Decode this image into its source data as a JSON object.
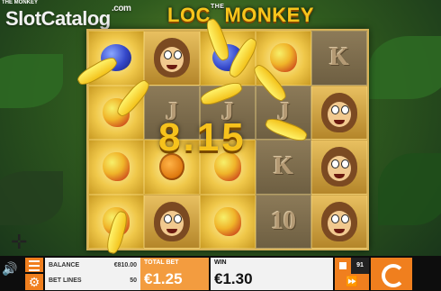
{
  "watermark": {
    "brand": "SlotCatalog",
    "domain": ".com"
  },
  "header": {
    "small_title": "THE MONKEY",
    "logo_text": "LOC",
    "logo_text_2": "MONKEY",
    "logo_small": "THE"
  },
  "win_overlay": {
    "amount": "8.15"
  },
  "reels": [
    [
      "plum",
      "mango",
      "mango",
      "mango"
    ],
    [
      "monkey",
      "J",
      "lychee",
      "monkey"
    ],
    [
      "plum",
      "J",
      "mango",
      "mango"
    ],
    [
      "mango",
      "J",
      "K",
      "10"
    ],
    [
      "K",
      "monkey",
      "monkey",
      "monkey"
    ]
  ],
  "bottom_bar": {
    "balance_label": "BALANCE",
    "balance_value": "€810.00",
    "bet_lines_label": "BET LINES",
    "bet_lines_value": "50",
    "total_bet_label": "TOTAL BET",
    "total_bet_value": "€1.25",
    "win_label": "WIN",
    "win_value": "€1.30",
    "autoplay_count": "91",
    "fast_label": "⏩"
  },
  "colors": {
    "accent": "#f07f1e",
    "win_text": "#f6c21c",
    "frame": "#d7b25a"
  },
  "icons": {
    "menu": "hamburger-menu-icon",
    "settings": "gear-icon",
    "spin": "spin-arrow-icon",
    "autoplay": "stop-square-icon",
    "fast": "fast-forward-icon"
  }
}
